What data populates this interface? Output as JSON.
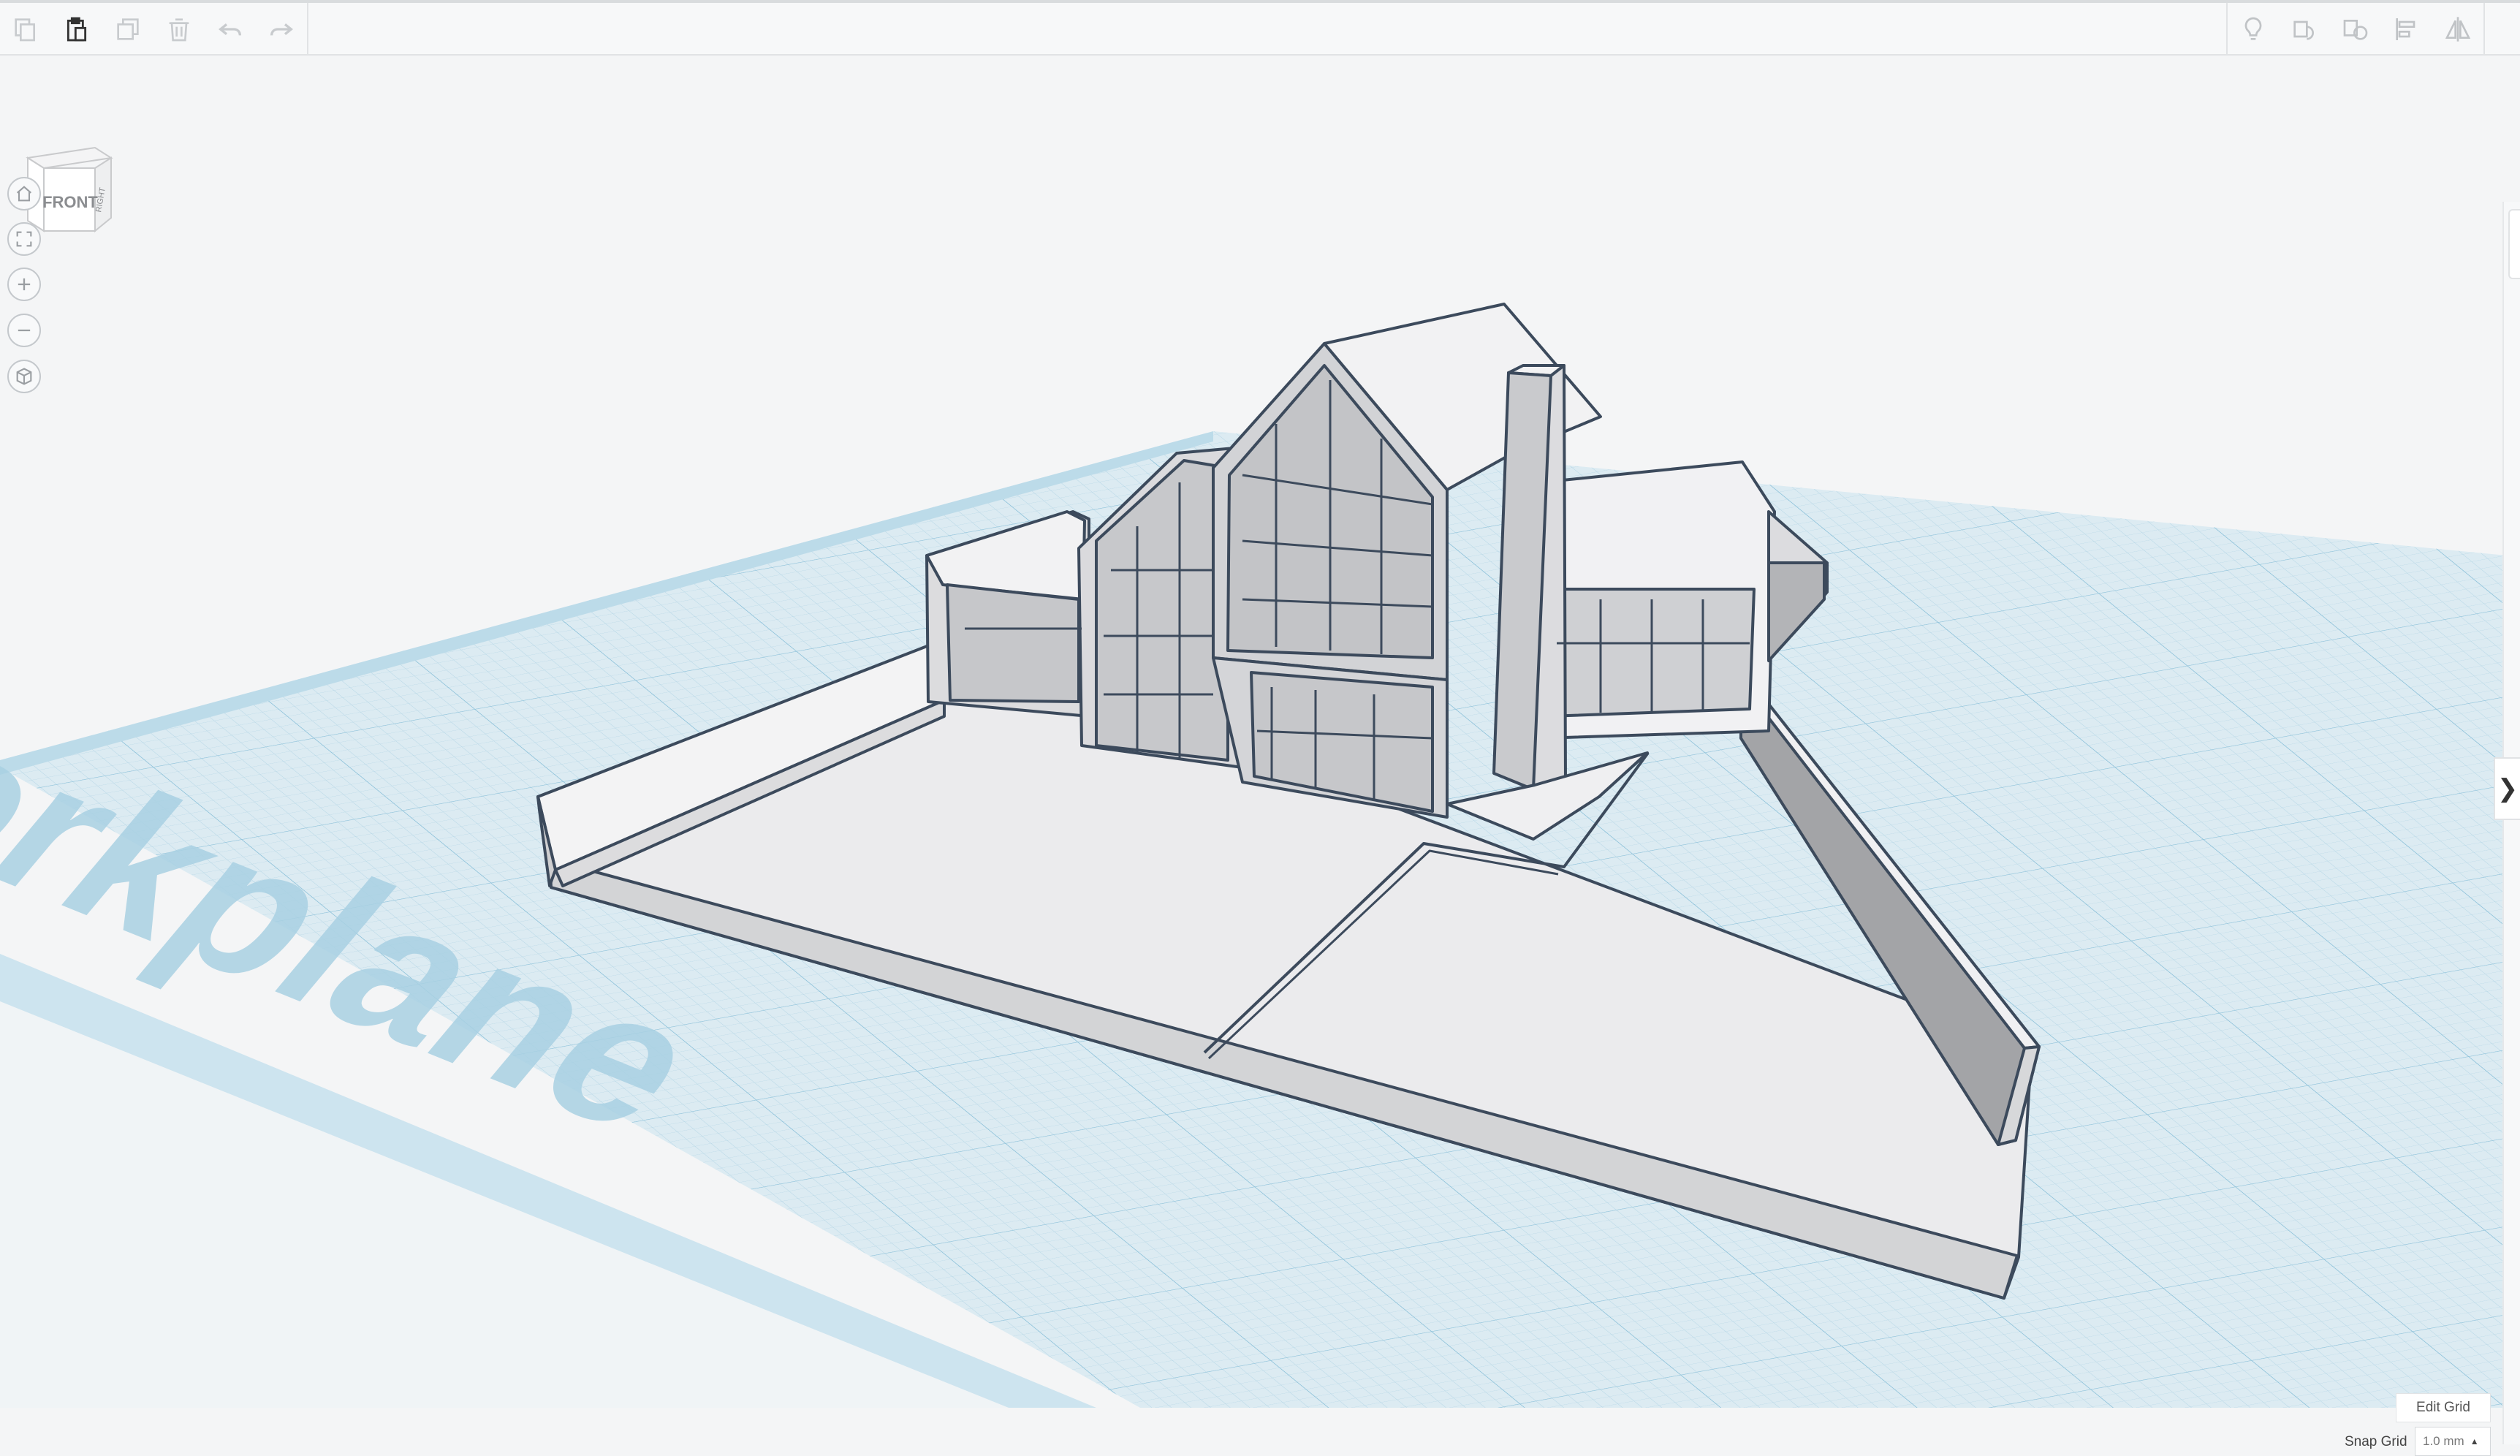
{
  "toolbar": {
    "left_tools": [
      {
        "name": "copy-icon",
        "enabled": false
      },
      {
        "name": "paste-icon",
        "enabled": true
      },
      {
        "name": "duplicate-icon",
        "enabled": false
      },
      {
        "name": "delete-icon",
        "enabled": false
      },
      {
        "name": "undo-icon",
        "enabled": false
      },
      {
        "name": "redo-icon",
        "enabled": false
      }
    ],
    "right_tools": [
      {
        "name": "show-all-icon"
      },
      {
        "name": "group-icon"
      },
      {
        "name": "ungroup-icon"
      },
      {
        "name": "align-icon"
      },
      {
        "name": "mirror-icon"
      }
    ]
  },
  "viewcube": {
    "front_label": "FRONT",
    "right_label": "RIGHT"
  },
  "nav_controls": [
    "home-view-icon",
    "fit-all-icon",
    "zoom-in-icon",
    "zoom-out-icon",
    "ortho-perspective-icon"
  ],
  "workplane": {
    "label": "Workplane"
  },
  "right_panel_toggle": {
    "glyph": "❯"
  },
  "grid_controls": {
    "edit_grid_label": "Edit Grid",
    "snap_grid_label": "Snap Grid",
    "snap_grid_value": "1.0 mm"
  },
  "colors": {
    "grid_fill": "#dbeaf1",
    "grid_line": "#a8cfe0",
    "grid_major": "#7fb9d3",
    "model_fill": "#ececee",
    "model_shade": "#b5b7ba",
    "model_outline": "#3c4a5c"
  }
}
